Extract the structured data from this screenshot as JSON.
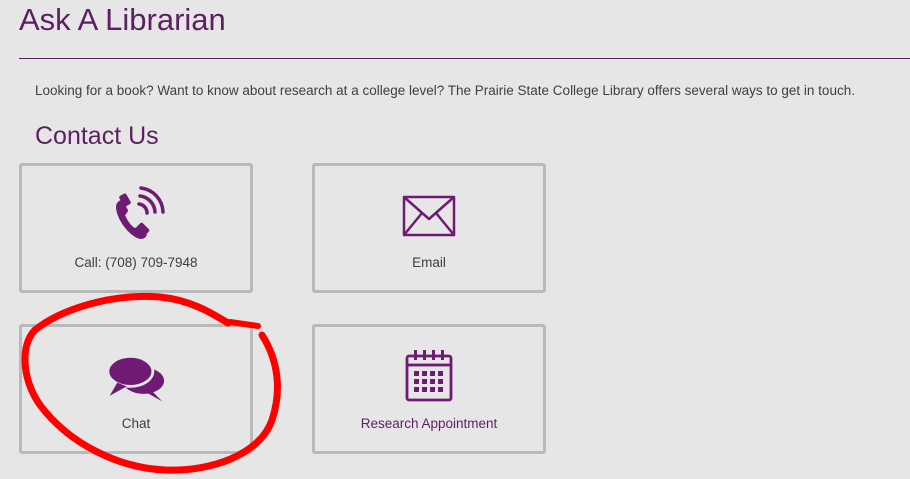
{
  "page": {
    "title": "Ask A Librarian",
    "intro": "Looking for a book? Want to know about research at a college level? The Prairie State College Library offers several ways to get in touch.",
    "section_heading": "Contact Us"
  },
  "contact_options": [
    {
      "label": "Call: (708) 709-7948",
      "icon": "phone-icon"
    },
    {
      "label": "Email",
      "icon": "envelope-icon"
    },
    {
      "label": "Chat",
      "icon": "chat-bubbles-icon"
    },
    {
      "label": "Research Appointment",
      "icon": "calendar-icon"
    }
  ],
  "colors": {
    "brand_purple": "#5d1f63",
    "background": "#e6e6e6",
    "tile_border": "#b9b9b9",
    "annotation_red": "#ff0000"
  }
}
